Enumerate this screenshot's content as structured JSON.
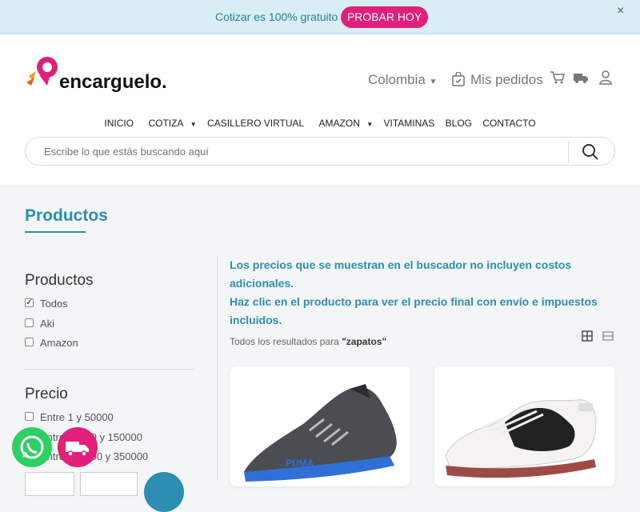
{
  "promo": {
    "text": "Cotizar es 100% gratuito",
    "button": "PROBAR HOY",
    "close": "×"
  },
  "header": {
    "logo_text": "encarguelo.",
    "country": "Colombia",
    "orders": "Mis pedidos",
    "nav": [
      "INICIO",
      "COTIZA",
      "CASILLERO VIRTUAL",
      "AMAZON",
      "VITAMINAS",
      "BLOG",
      "CONTACTO"
    ],
    "search_placeholder": "Escribe lo que estás buscando aquí"
  },
  "page": {
    "title": "Productos"
  },
  "sidebar": {
    "products_title": "Productos",
    "products": [
      {
        "label": "Todos",
        "checked": true
      },
      {
        "label": "Aki",
        "checked": false
      },
      {
        "label": "Amazon",
        "checked": false
      }
    ],
    "price_title": "Precio",
    "prices": [
      "Entre 1 y 50000",
      "Entre 50000 y 150000",
      "Entre 150000 y 350000"
    ]
  },
  "main": {
    "notice_line1": "Los precios que se muestran en el buscador no incluyen costos adicionales.",
    "notice_line2": "Haz clic en el producto para ver el precio final con envío e impuestos incluidos.",
    "results_prefix": "Todos los resultados para",
    "query": "\"zapatos\""
  },
  "colors": {
    "accent": "#2c8fb2",
    "brand": "#e21f7a",
    "whatsapp": "#2dd163"
  }
}
